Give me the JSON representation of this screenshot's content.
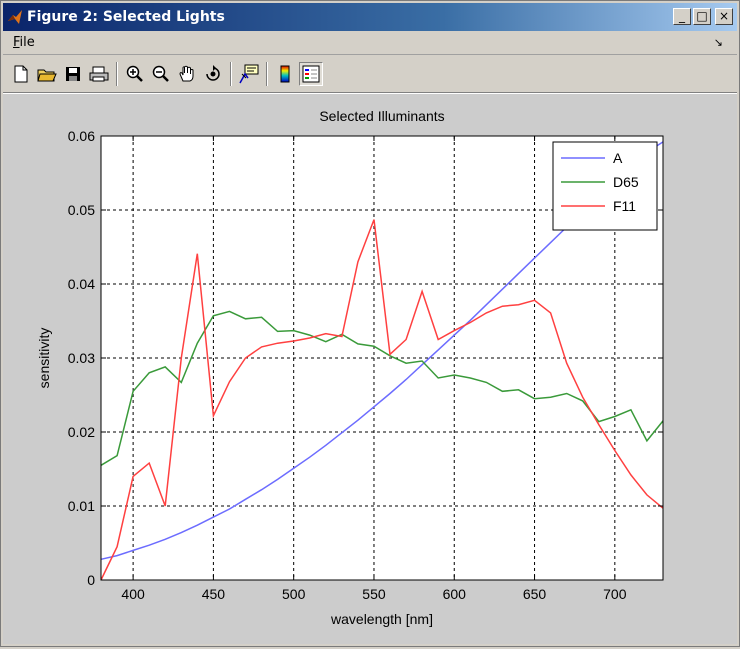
{
  "window": {
    "title": "Figure 2: Selected Lights",
    "minimize_label": "_",
    "maximize_label": "□",
    "close_label": "×"
  },
  "menu": {
    "file_label": "File",
    "file_mnemonic": "F",
    "file_rest": "ile",
    "dock_arrow": "↘"
  },
  "toolbar": {
    "buttons": [
      "new-figure",
      "open-file",
      "save",
      "print",
      "zoom-in",
      "zoom-out",
      "pan",
      "rotate-3d",
      "data-cursor",
      "colorbar",
      "legend"
    ]
  },
  "chart_data": {
    "type": "line",
    "title": "Selected Illuminants",
    "xlabel": "wavelength [nm]",
    "ylabel": "sensitivity",
    "xlim": [
      380,
      730
    ],
    "ylim": [
      0,
      0.06
    ],
    "xticks": [
      400,
      450,
      500,
      550,
      600,
      650,
      700
    ],
    "yticks": [
      0,
      0.01,
      0.02,
      0.03,
      0.04,
      0.05,
      0.06
    ],
    "xtick_labels": [
      "400",
      "450",
      "500",
      "550",
      "600",
      "650",
      "700"
    ],
    "ytick_labels": [
      "0",
      "0.01",
      "0.02",
      "0.03",
      "0.04",
      "0.05",
      "0.06"
    ],
    "grid": true,
    "legend_position": "top-right",
    "x": [
      380,
      390,
      400,
      410,
      420,
      430,
      440,
      450,
      460,
      470,
      480,
      490,
      500,
      510,
      520,
      530,
      540,
      550,
      560,
      570,
      580,
      590,
      600,
      610,
      620,
      630,
      640,
      650,
      660,
      670,
      680,
      690,
      700,
      710,
      720,
      730
    ],
    "series": [
      {
        "name": "A",
        "color": "#6c6cff",
        "values": [
          0.0028,
          0.0033,
          0.004,
          0.0047,
          0.0055,
          0.0064,
          0.0074,
          0.0085,
          0.0096,
          0.0109,
          0.0122,
          0.0136,
          0.0151,
          0.0166,
          0.0182,
          0.0199,
          0.0216,
          0.0234,
          0.0252,
          0.0271,
          0.0291,
          0.0311,
          0.0331,
          0.0351,
          0.0372,
          0.0393,
          0.0414,
          0.0435,
          0.0456,
          0.0477,
          0.0498,
          0.0519,
          0.054,
          0.0561,
          0.0578,
          0.0592
        ]
      },
      {
        "name": "D65",
        "color": "#3a9a3a",
        "values": [
          0.0155,
          0.0168,
          0.0255,
          0.028,
          0.0288,
          0.0267,
          0.032,
          0.0357,
          0.0363,
          0.0353,
          0.0355,
          0.0336,
          0.0337,
          0.0331,
          0.0322,
          0.0332,
          0.0319,
          0.0316,
          0.0303,
          0.0293,
          0.0296,
          0.0273,
          0.0277,
          0.0273,
          0.0267,
          0.0255,
          0.0257,
          0.0245,
          0.0247,
          0.0252,
          0.0242,
          0.0214,
          0.0221,
          0.023,
          0.0188,
          0.0215
        ]
      },
      {
        "name": "F11",
        "color": "#ff4040",
        "values": [
          0.0,
          0.0045,
          0.014,
          0.0158,
          0.01,
          0.03,
          0.0441,
          0.0222,
          0.0268,
          0.03,
          0.0315,
          0.032,
          0.0323,
          0.0327,
          0.0333,
          0.0329,
          0.043,
          0.0487,
          0.0305,
          0.0325,
          0.039,
          0.0325,
          0.0337,
          0.0348,
          0.0361,
          0.037,
          0.0372,
          0.0378,
          0.0361,
          0.0293,
          0.0247,
          0.021,
          0.0175,
          0.0142,
          0.0115,
          0.0097
        ]
      }
    ]
  }
}
